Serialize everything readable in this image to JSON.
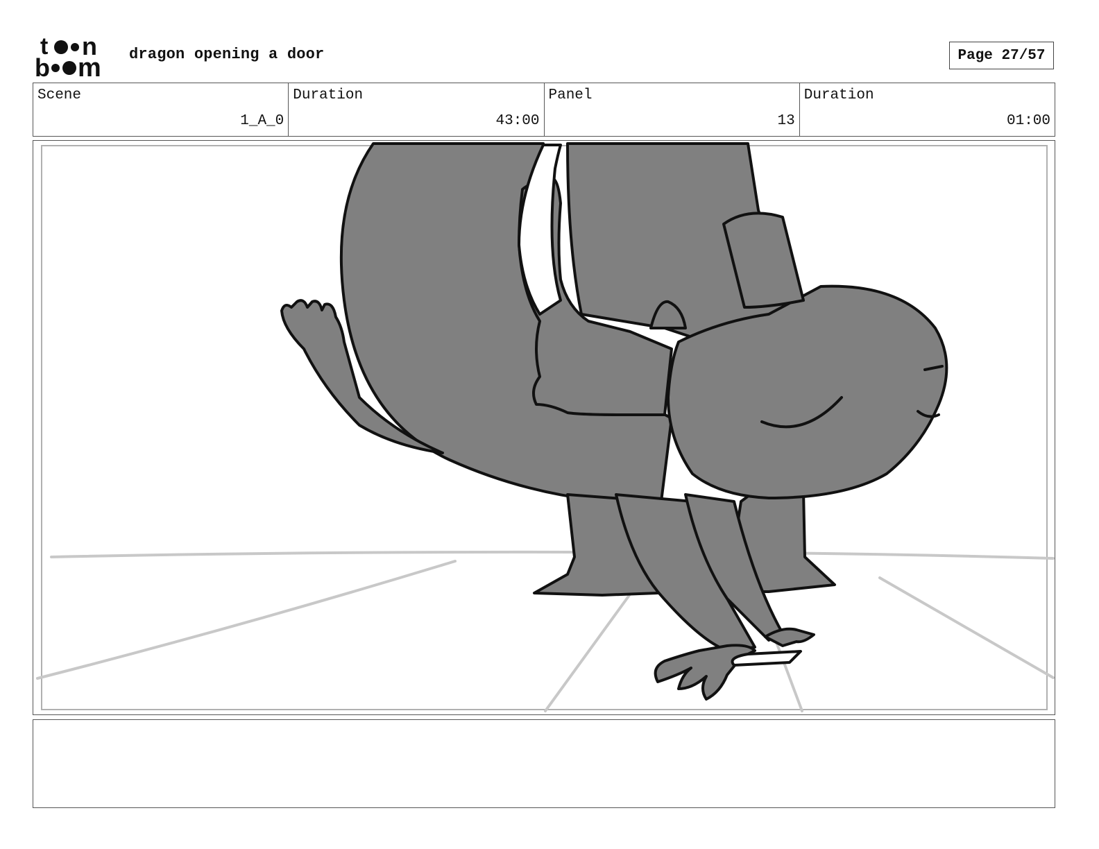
{
  "header": {
    "logo_text": "toon boom",
    "title": "dragon opening a door",
    "page_label": "Page 27/57"
  },
  "info": {
    "scene_label": "Scene",
    "scene_value": "1_A_0",
    "scene_duration_label": "Duration",
    "scene_duration_value": "43:00",
    "panel_label": "Panel",
    "panel_value": "13",
    "panel_duration_label": "Duration",
    "panel_duration_value": "01:00"
  },
  "panel": {
    "image_description_icon": "storyboard-sketch",
    "colors": {
      "fill": "#808080",
      "ink": "#111111",
      "guide": "#c8c8c8"
    }
  },
  "notes": {
    "text": ""
  }
}
